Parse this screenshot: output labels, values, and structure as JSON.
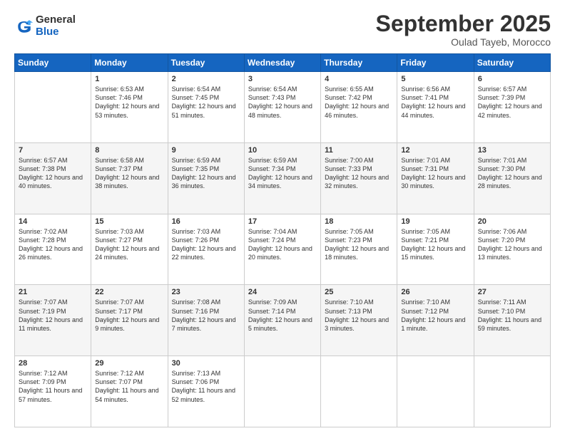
{
  "logo": {
    "general": "General",
    "blue": "Blue"
  },
  "header": {
    "title": "September 2025",
    "location": "Oulad Tayeb, Morocco"
  },
  "weekdays": [
    "Sunday",
    "Monday",
    "Tuesday",
    "Wednesday",
    "Thursday",
    "Friday",
    "Saturday"
  ],
  "weeks": [
    [
      {
        "day": "",
        "sunrise": "",
        "sunset": "",
        "daylight": ""
      },
      {
        "day": "1",
        "sunrise": "Sunrise: 6:53 AM",
        "sunset": "Sunset: 7:46 PM",
        "daylight": "Daylight: 12 hours and 53 minutes."
      },
      {
        "day": "2",
        "sunrise": "Sunrise: 6:54 AM",
        "sunset": "Sunset: 7:45 PM",
        "daylight": "Daylight: 12 hours and 51 minutes."
      },
      {
        "day": "3",
        "sunrise": "Sunrise: 6:54 AM",
        "sunset": "Sunset: 7:43 PM",
        "daylight": "Daylight: 12 hours and 48 minutes."
      },
      {
        "day": "4",
        "sunrise": "Sunrise: 6:55 AM",
        "sunset": "Sunset: 7:42 PM",
        "daylight": "Daylight: 12 hours and 46 minutes."
      },
      {
        "day": "5",
        "sunrise": "Sunrise: 6:56 AM",
        "sunset": "Sunset: 7:41 PM",
        "daylight": "Daylight: 12 hours and 44 minutes."
      },
      {
        "day": "6",
        "sunrise": "Sunrise: 6:57 AM",
        "sunset": "Sunset: 7:39 PM",
        "daylight": "Daylight: 12 hours and 42 minutes."
      }
    ],
    [
      {
        "day": "7",
        "sunrise": "Sunrise: 6:57 AM",
        "sunset": "Sunset: 7:38 PM",
        "daylight": "Daylight: 12 hours and 40 minutes."
      },
      {
        "day": "8",
        "sunrise": "Sunrise: 6:58 AM",
        "sunset": "Sunset: 7:37 PM",
        "daylight": "Daylight: 12 hours and 38 minutes."
      },
      {
        "day": "9",
        "sunrise": "Sunrise: 6:59 AM",
        "sunset": "Sunset: 7:35 PM",
        "daylight": "Daylight: 12 hours and 36 minutes."
      },
      {
        "day": "10",
        "sunrise": "Sunrise: 6:59 AM",
        "sunset": "Sunset: 7:34 PM",
        "daylight": "Daylight: 12 hours and 34 minutes."
      },
      {
        "day": "11",
        "sunrise": "Sunrise: 7:00 AM",
        "sunset": "Sunset: 7:33 PM",
        "daylight": "Daylight: 12 hours and 32 minutes."
      },
      {
        "day": "12",
        "sunrise": "Sunrise: 7:01 AM",
        "sunset": "Sunset: 7:31 PM",
        "daylight": "Daylight: 12 hours and 30 minutes."
      },
      {
        "day": "13",
        "sunrise": "Sunrise: 7:01 AM",
        "sunset": "Sunset: 7:30 PM",
        "daylight": "Daylight: 12 hours and 28 minutes."
      }
    ],
    [
      {
        "day": "14",
        "sunrise": "Sunrise: 7:02 AM",
        "sunset": "Sunset: 7:28 PM",
        "daylight": "Daylight: 12 hours and 26 minutes."
      },
      {
        "day": "15",
        "sunrise": "Sunrise: 7:03 AM",
        "sunset": "Sunset: 7:27 PM",
        "daylight": "Daylight: 12 hours and 24 minutes."
      },
      {
        "day": "16",
        "sunrise": "Sunrise: 7:03 AM",
        "sunset": "Sunset: 7:26 PM",
        "daylight": "Daylight: 12 hours and 22 minutes."
      },
      {
        "day": "17",
        "sunrise": "Sunrise: 7:04 AM",
        "sunset": "Sunset: 7:24 PM",
        "daylight": "Daylight: 12 hours and 20 minutes."
      },
      {
        "day": "18",
        "sunrise": "Sunrise: 7:05 AM",
        "sunset": "Sunset: 7:23 PM",
        "daylight": "Daylight: 12 hours and 18 minutes."
      },
      {
        "day": "19",
        "sunrise": "Sunrise: 7:05 AM",
        "sunset": "Sunset: 7:21 PM",
        "daylight": "Daylight: 12 hours and 15 minutes."
      },
      {
        "day": "20",
        "sunrise": "Sunrise: 7:06 AM",
        "sunset": "Sunset: 7:20 PM",
        "daylight": "Daylight: 12 hours and 13 minutes."
      }
    ],
    [
      {
        "day": "21",
        "sunrise": "Sunrise: 7:07 AM",
        "sunset": "Sunset: 7:19 PM",
        "daylight": "Daylight: 12 hours and 11 minutes."
      },
      {
        "day": "22",
        "sunrise": "Sunrise: 7:07 AM",
        "sunset": "Sunset: 7:17 PM",
        "daylight": "Daylight: 12 hours and 9 minutes."
      },
      {
        "day": "23",
        "sunrise": "Sunrise: 7:08 AM",
        "sunset": "Sunset: 7:16 PM",
        "daylight": "Daylight: 12 hours and 7 minutes."
      },
      {
        "day": "24",
        "sunrise": "Sunrise: 7:09 AM",
        "sunset": "Sunset: 7:14 PM",
        "daylight": "Daylight: 12 hours and 5 minutes."
      },
      {
        "day": "25",
        "sunrise": "Sunrise: 7:10 AM",
        "sunset": "Sunset: 7:13 PM",
        "daylight": "Daylight: 12 hours and 3 minutes."
      },
      {
        "day": "26",
        "sunrise": "Sunrise: 7:10 AM",
        "sunset": "Sunset: 7:12 PM",
        "daylight": "Daylight: 12 hours and 1 minute."
      },
      {
        "day": "27",
        "sunrise": "Sunrise: 7:11 AM",
        "sunset": "Sunset: 7:10 PM",
        "daylight": "Daylight: 11 hours and 59 minutes."
      }
    ],
    [
      {
        "day": "28",
        "sunrise": "Sunrise: 7:12 AM",
        "sunset": "Sunset: 7:09 PM",
        "daylight": "Daylight: 11 hours and 57 minutes."
      },
      {
        "day": "29",
        "sunrise": "Sunrise: 7:12 AM",
        "sunset": "Sunset: 7:07 PM",
        "daylight": "Daylight: 11 hours and 54 minutes."
      },
      {
        "day": "30",
        "sunrise": "Sunrise: 7:13 AM",
        "sunset": "Sunset: 7:06 PM",
        "daylight": "Daylight: 11 hours and 52 minutes."
      },
      {
        "day": "",
        "sunrise": "",
        "sunset": "",
        "daylight": ""
      },
      {
        "day": "",
        "sunrise": "",
        "sunset": "",
        "daylight": ""
      },
      {
        "day": "",
        "sunrise": "",
        "sunset": "",
        "daylight": ""
      },
      {
        "day": "",
        "sunrise": "",
        "sunset": "",
        "daylight": ""
      }
    ]
  ]
}
